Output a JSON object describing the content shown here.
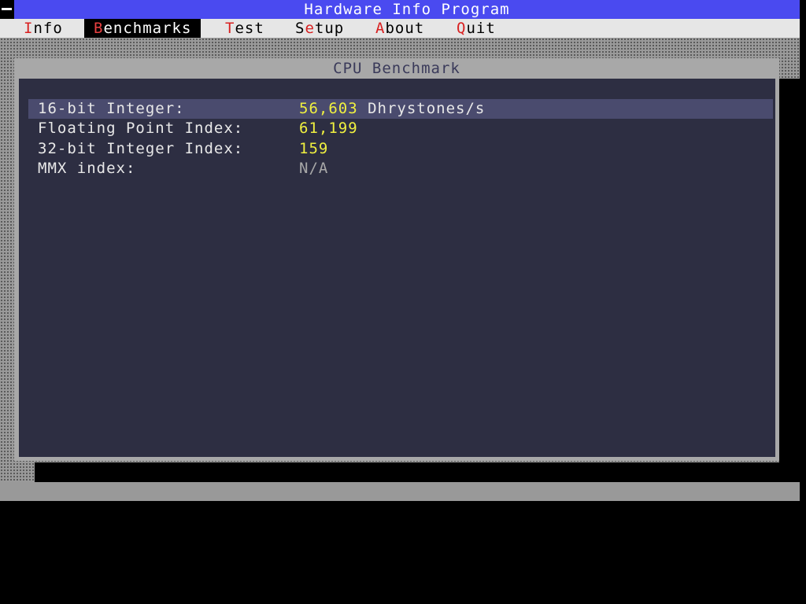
{
  "app": {
    "title": "Hardware Info Program"
  },
  "menu": [
    {
      "hot": "I",
      "rest": "nfo",
      "active": false
    },
    {
      "hot": "B",
      "rest": "enchmarks",
      "active": true
    },
    {
      "hot": "T",
      "rest": "est",
      "active": false
    },
    {
      "pre": "S",
      "hot": "e",
      "rest": "tup",
      "active": false
    },
    {
      "hot": "A",
      "rest": "bout",
      "active": false
    },
    {
      "hot": "Q",
      "rest": "uit",
      "active": false
    }
  ],
  "window": {
    "title": "CPU Benchmark",
    "rows": [
      {
        "label": "16-bit Integer:",
        "value": "56,603",
        "unit": " Dhrystones/s",
        "selected": true
      },
      {
        "label": "Floating Point Index:",
        "value": "61,199",
        "unit": "",
        "selected": false
      },
      {
        "label": "32-bit Integer Index:",
        "value": "159",
        "unit": "",
        "selected": false
      },
      {
        "label": "MMX index:",
        "value": "N/A",
        "unit": "",
        "selected": false
      }
    ]
  },
  "icons": {
    "system_menu": "system-menu-icon"
  },
  "colors": {
    "title_bar": "#4a4af0",
    "menu_bar": "#e6e6e6",
    "hotkey": "#d82020",
    "window_body": "#2d2e42",
    "selected_row": "#4a4b6e",
    "value_text": "#f0f040"
  }
}
